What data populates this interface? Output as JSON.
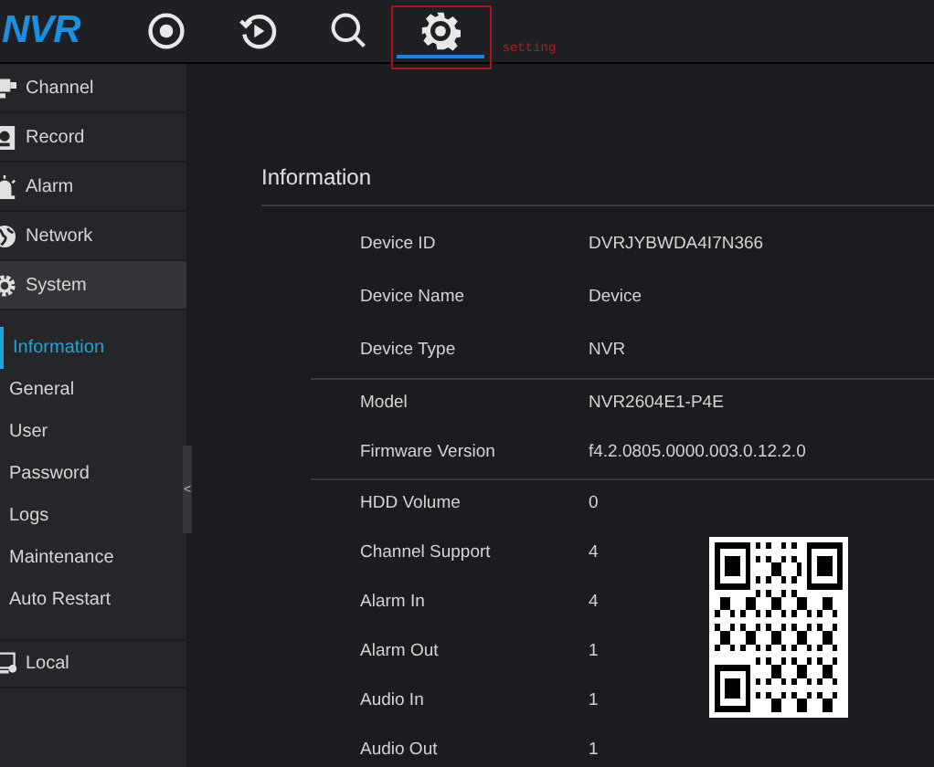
{
  "top_bar": {
    "logo": "NVR",
    "nav": [
      {
        "kind": "record",
        "selected": false
      },
      {
        "kind": "playback",
        "selected": false
      },
      {
        "kind": "search",
        "selected": false
      },
      {
        "kind": "setting",
        "selected": true
      }
    ],
    "annotation": {
      "label": "setting"
    }
  },
  "sidebar": {
    "items": [
      {
        "label": "Channel",
        "kind": "channel",
        "selected": false
      },
      {
        "label": "Record",
        "kind": "record",
        "selected": false
      },
      {
        "label": "Alarm",
        "kind": "alarm",
        "selected": false
      },
      {
        "label": "Network",
        "kind": "network",
        "selected": false
      },
      {
        "label": "System",
        "kind": "system",
        "selected": true,
        "children": [
          {
            "label": "Information",
            "selected": true
          },
          {
            "label": "General",
            "selected": false
          },
          {
            "label": "User",
            "selected": false
          },
          {
            "label": "Password",
            "selected": false
          },
          {
            "label": "Logs",
            "selected": false
          },
          {
            "label": "Maintenance",
            "selected": false
          },
          {
            "label": "Auto Restart",
            "selected": false
          }
        ]
      },
      {
        "label": "Local",
        "kind": "local",
        "selected": false
      }
    ],
    "collapse_handle": "<"
  },
  "panel": {
    "title": "Information",
    "groups": [
      [
        {
          "label": "Device ID",
          "value": "DVRJYBWDA4I7N366"
        },
        {
          "label": "Device Name",
          "value": "Device"
        },
        {
          "label": "Device Type",
          "value": "NVR"
        }
      ],
      [
        {
          "label": "Model",
          "value": "NVR2604E1-P4E"
        },
        {
          "label": "Firmware Version",
          "value": "f4.2.0805.0000.003.0.12.2.0"
        }
      ],
      [
        {
          "label": "HDD Volume",
          "value": "0"
        },
        {
          "label": "Channel Support",
          "value": "4"
        },
        {
          "label": "Alarm In",
          "value": "4"
        },
        {
          "label": "Alarm Out",
          "value": "1"
        },
        {
          "label": "Audio In",
          "value": "1"
        },
        {
          "label": "Audio Out",
          "value": "1"
        }
      ]
    ]
  }
}
